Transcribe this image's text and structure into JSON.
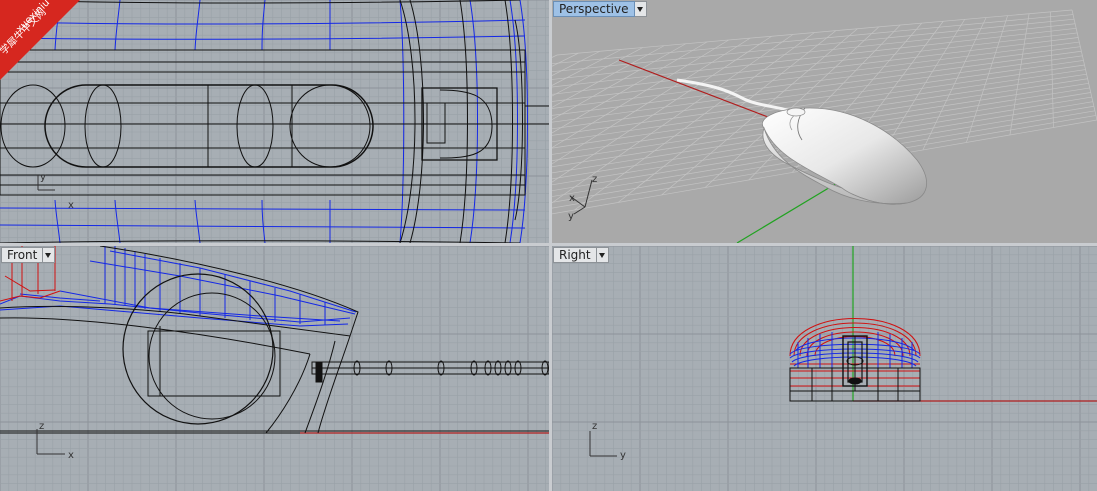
{
  "watermark": {
    "line1": "xuexiniu",
    "line2": "学犀牛中文网"
  },
  "viewports": {
    "top": {
      "axis_x": "x",
      "axis_y": "y"
    },
    "perspective": {
      "label": "Perspective",
      "axis_x": "x",
      "axis_y": "y",
      "axis_z": "z"
    },
    "front": {
      "label": "Front",
      "axis_x": "x",
      "axis_z": "z"
    },
    "right": {
      "label": "Right",
      "axis_y": "y",
      "axis_z": "z"
    }
  },
  "colors": {
    "grid": "#9aa1a7",
    "grid_major": "#8c939a",
    "viewport_bg": "#a7aeb4",
    "perspective_bg": "#a9a9a9",
    "x_axis": "#b01e1e",
    "y_axis": "#21a321",
    "wire_black": "#111111",
    "wire_blue": "#1428e6",
    "wire_red": "#d01010",
    "active_label": "#9ec1e6",
    "watermark": "#d6271f"
  }
}
